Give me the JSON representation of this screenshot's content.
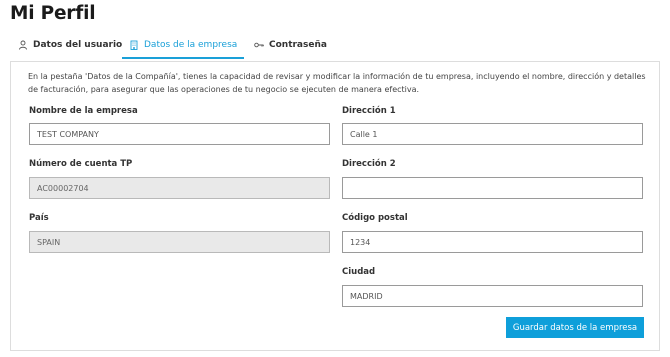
{
  "page": {
    "title": "Mi Perfil"
  },
  "tabs": [
    {
      "label": "Datos del usuario",
      "icon": "user-icon",
      "active": false
    },
    {
      "label": "Datos de la empresa",
      "icon": "building-icon",
      "active": true
    },
    {
      "label": "Contraseña",
      "icon": "key-icon",
      "active": false
    }
  ],
  "description": "En la pestaña 'Datos de la Compañía', tienes la capacidad de revisar y modificar la información de tu empresa, incluyendo el nombre, dirección y detalles de facturación, para asegurar que las operaciones de tu negocio se ejecuten de manera efectiva.",
  "form": {
    "company_name": {
      "label": "Nombre de la empresa",
      "value": "TEST COMPANY"
    },
    "tp_account": {
      "label": "Número de cuenta TP",
      "value": "AC00002704"
    },
    "country": {
      "label": "País",
      "value": "SPAIN"
    },
    "address1": {
      "label": "Dirección 1",
      "value": "Calle 1"
    },
    "address2": {
      "label": "Dirección 2",
      "value": ""
    },
    "postal_code": {
      "label": "Código postal",
      "value": "1234"
    },
    "city": {
      "label": "Ciudad",
      "value": "MADRID"
    }
  },
  "actions": {
    "save_label": "Guardar datos de la empresa"
  },
  "colors": {
    "accent": "#1aa0d8",
    "button": "#0e9fda",
    "readonly_bg": "#e9e9e9"
  }
}
